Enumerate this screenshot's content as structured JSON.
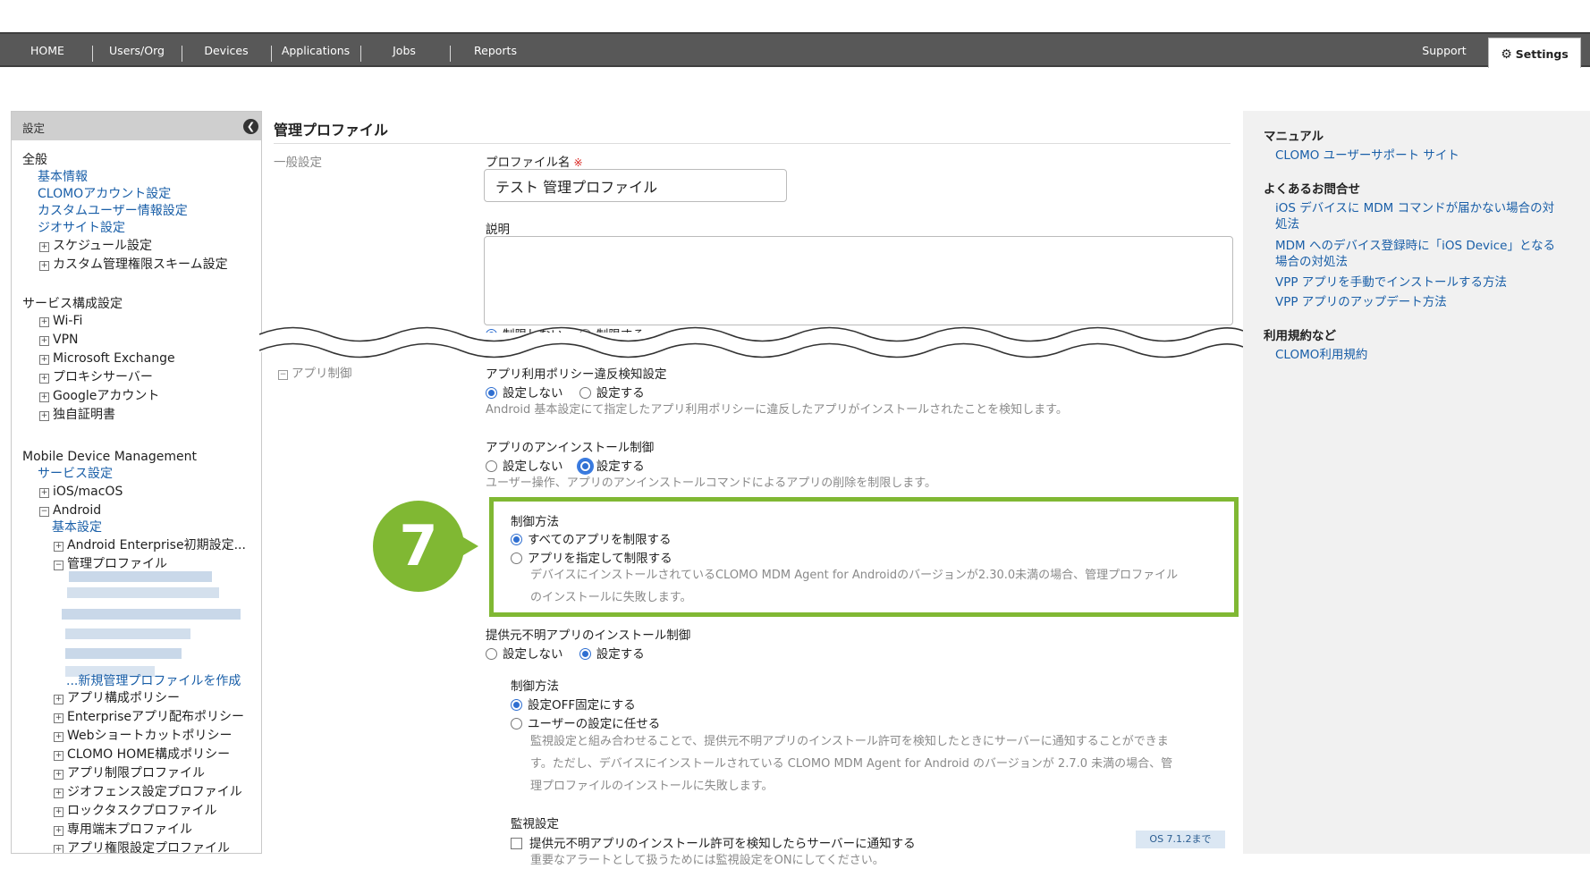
{
  "nav": {
    "items": [
      "HOME",
      "Users/Org",
      "Devices",
      "Applications",
      "Jobs",
      "Reports"
    ],
    "support": "Support",
    "settings": "Settings"
  },
  "sidebar": {
    "title": "設定",
    "general_heading": "全般",
    "general": [
      "基本情報",
      "CLOMOアカウント設定",
      "カスタムユーザー情報設定",
      "ジオサイト設定"
    ],
    "general_tree": [
      "スケジュール設定",
      "カスタム管理権限スキーム設定"
    ],
    "service_heading": "サービス構成設定",
    "service_tree": [
      "Wi-Fi",
      "VPN",
      "Microsoft Exchange",
      "プロキシサーバー",
      "Googleアカウント",
      "独自証明書"
    ],
    "mdm_heading": "Mobile Device Management",
    "mdm_service": "サービス設定",
    "ios": "iOS/macOS",
    "android": "Android",
    "android_basic": "基本設定",
    "android_enterprise": "Android Enterprise初期設定...",
    "managed_profile": "管理プロファイル",
    "new_profile": "...新規管理プロファイルを作成",
    "android_tree": [
      "アプリ構成ポリシー",
      "Enterpriseアプリ配布ポリシー",
      "Webショートカットポリシー",
      "CLOMO HOME構成ポリシー",
      "アプリ制限プロファイル",
      "ジオフェンス設定プロファイル",
      "ロックタスクプロファイル",
      "専用端末プロファイル",
      "アプリ権限設定プロファイル"
    ]
  },
  "main": {
    "title": "管理プロファイル",
    "general_section": "一般設定",
    "profile_name_label": "プロファイル名",
    "required_mark": "※",
    "profile_name_value": "テスト 管理プロファイル",
    "description_label": "説明",
    "clipped_radio": [
      "制限しない",
      "制限する"
    ],
    "app_control_section": "アプリ制御",
    "policy_violation": {
      "label": "アプリ利用ポリシー違反検知設定",
      "options": [
        "設定しない",
        "設定する"
      ],
      "help": "Android 基本設定にて指定したアプリ利用ポリシーに違反したアプリがインストールされたことを検知します。"
    },
    "uninstall": {
      "label": "アプリのアンインストール制御",
      "options": [
        "設定しない",
        "設定する"
      ],
      "help": "ユーザー操作、アプリのアンインストールコマンドによるアプリの削除を制限します。"
    },
    "callout": {
      "step": "7",
      "method_label": "制御方法",
      "options": [
        "すべてのアプリを制限する",
        "アプリを指定して制限する"
      ],
      "help_line1": "デバイスにインストールされているCLOMO MDM Agent for Androidのバージョンが2.30.0未満の場合、管理プロファイル",
      "help_line2": "のインストールに失敗します。"
    },
    "unknown_source": {
      "label": "提供元不明アプリのインストール制御",
      "options": [
        "設定しない",
        "設定する"
      ],
      "method_label": "制御方法",
      "method_options": [
        "設定OFF固定にする",
        "ユーザーの設定に任せる"
      ],
      "help_line1": "監視設定と組み合わせることで、提供元不明アプリのインストール許可を検知したときにサーバーに通知することができま",
      "help_line2": "す。ただし、デバイスにインストールされている CLOMO MDM Agent for Android のバージョンが 2.7.0 未満の場合、管",
      "help_line3": "理プロファイルのインストールに失敗します。",
      "monitor_label": "監視設定",
      "monitor_checkbox": "提供元不明アプリのインストール許可を検知したらサーバーに通知する",
      "os_badge": "OS 7.1.2まで",
      "monitor_help": "重要なアラートとして扱うためには監視設定をONにしてください。"
    }
  },
  "right": {
    "manual_heading": "マニュアル",
    "manual_link": "CLOMO ユーザーサポート サイト",
    "faq_heading": "よくあるお問合せ",
    "faq1_line1": "iOS デバイスに MDM コマンドが届かない場合の対",
    "faq1_line2": "処法",
    "faq2_line1": "MDM へのデバイス登録時に「iOS Device」となる",
    "faq2_line2": "場合の対処法",
    "faq3": "VPP アプリを手動でインストールする方法",
    "faq4": "VPP アプリのアップデート方法",
    "terms_heading": "利用規約など",
    "terms_link": "CLOMO利用規約"
  },
  "colors": {
    "nav_bg": "#585858",
    "link": "#1a5fa8",
    "callout_green": "#80b833",
    "radio_accent": "#2f6fd1"
  }
}
